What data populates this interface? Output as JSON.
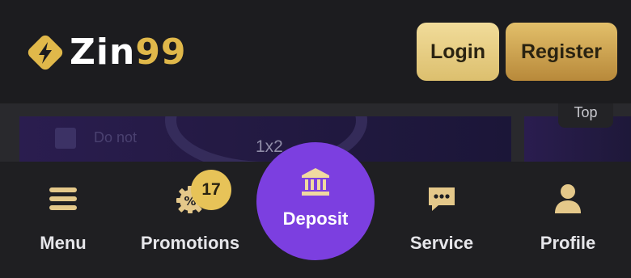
{
  "header": {
    "logo_text_main": "Zin",
    "logo_text_accent": "99",
    "login_label": "Login",
    "register_label": "Register"
  },
  "content": {
    "banner_odds": "1x2",
    "banner_faint_text": "Do not",
    "top_tab_label": "Top"
  },
  "nav": {
    "items": [
      {
        "label": "Menu",
        "icon": "hamburger-icon"
      },
      {
        "label": "Promotions",
        "icon": "promo-gear-percent-icon",
        "badge": "17"
      },
      {
        "label": "Deposit",
        "icon": "bank-icon"
      },
      {
        "label": "Service",
        "icon": "chat-icon"
      },
      {
        "label": "Profile",
        "icon": "user-icon"
      }
    ]
  },
  "colors": {
    "background": "#1f1f22",
    "gold_light": "#f1dc9a",
    "gold_dark": "#b8893a",
    "icon_gold": "#e4c88a",
    "deposit_purple": "#7c3fe0",
    "badge": "#e7c358"
  }
}
